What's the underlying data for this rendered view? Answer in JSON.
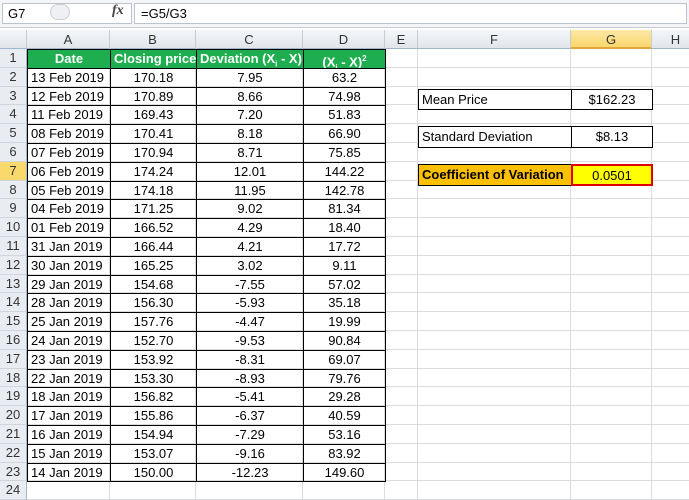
{
  "formula_bar": {
    "name_box": "G7",
    "fx_icon": "fx",
    "formula": "=G5/G3"
  },
  "columns": [
    "A",
    "B",
    "C",
    "D",
    "E",
    "F",
    "G",
    "H"
  ],
  "selected_column": "G",
  "selected_row": 7,
  "headers": [
    "Date",
    "Closing price",
    "Deviation (X",
    "i",
    " - X)",
    "(X",
    "i",
    " - X)",
    "2"
  ],
  "rows": [
    [
      "13 Feb 2019",
      "170.18",
      "7.95",
      "63.2"
    ],
    [
      "12 Feb 2019",
      "170.89",
      "8.66",
      "74.98"
    ],
    [
      "11 Feb 2019",
      "169.43",
      "7.20",
      "51.83"
    ],
    [
      "08 Feb 2019",
      "170.41",
      "8.18",
      "66.90"
    ],
    [
      "07 Feb 2019",
      "170.94",
      "8.71",
      "75.85"
    ],
    [
      "06 Feb 2019",
      "174.24",
      "12.01",
      "144.22"
    ],
    [
      "05 Feb 2019",
      "174.18",
      "11.95",
      "142.78"
    ],
    [
      "04 Feb 2019",
      "171.25",
      "9.02",
      "81.34"
    ],
    [
      "01 Feb 2019",
      "166.52",
      "4.29",
      "18.40"
    ],
    [
      "31 Jan 2019",
      "166.44",
      "4.21",
      "17.72"
    ],
    [
      "30 Jan 2019",
      "165.25",
      "3.02",
      "9.11"
    ],
    [
      "29 Jan 2019",
      "154.68",
      "-7.55",
      "57.02"
    ],
    [
      "28 Jan 2019",
      "156.30",
      "-5.93",
      "35.18"
    ],
    [
      "25 Jan 2019",
      "157.76",
      "-4.47",
      "19.99"
    ],
    [
      "24 Jan 2019",
      "152.70",
      "-9.53",
      "90.84"
    ],
    [
      "23 Jan 2019",
      "153.92",
      "-8.31",
      "69.07"
    ],
    [
      "22 Jan 2019",
      "153.30",
      "-8.93",
      "79.76"
    ],
    [
      "18 Jan 2019",
      "156.82",
      "-5.41",
      "29.28"
    ],
    [
      "17 Jan 2019",
      "155.86",
      "-6.37",
      "40.59"
    ],
    [
      "16 Jan 2019",
      "154.94",
      "-7.29",
      "53.16"
    ],
    [
      "15 Jan 2019",
      "153.07",
      "-9.16",
      "83.92"
    ],
    [
      "14 Jan 2019",
      "150.00",
      "-12.23",
      "149.60"
    ]
  ],
  "summary": {
    "mean_label": "Mean Price",
    "mean_value": "$162.23",
    "sd_label": "Standard Deviation",
    "sd_value": "$8.13",
    "cv_label": "Coefficient of Variation",
    "cv_value": "0.0501"
  },
  "colors": {
    "header_green": "#1fae4f",
    "cv_label_bg": "#ffc000",
    "cv_value_bg": "#ffff00",
    "selection_border": "#e00000"
  }
}
